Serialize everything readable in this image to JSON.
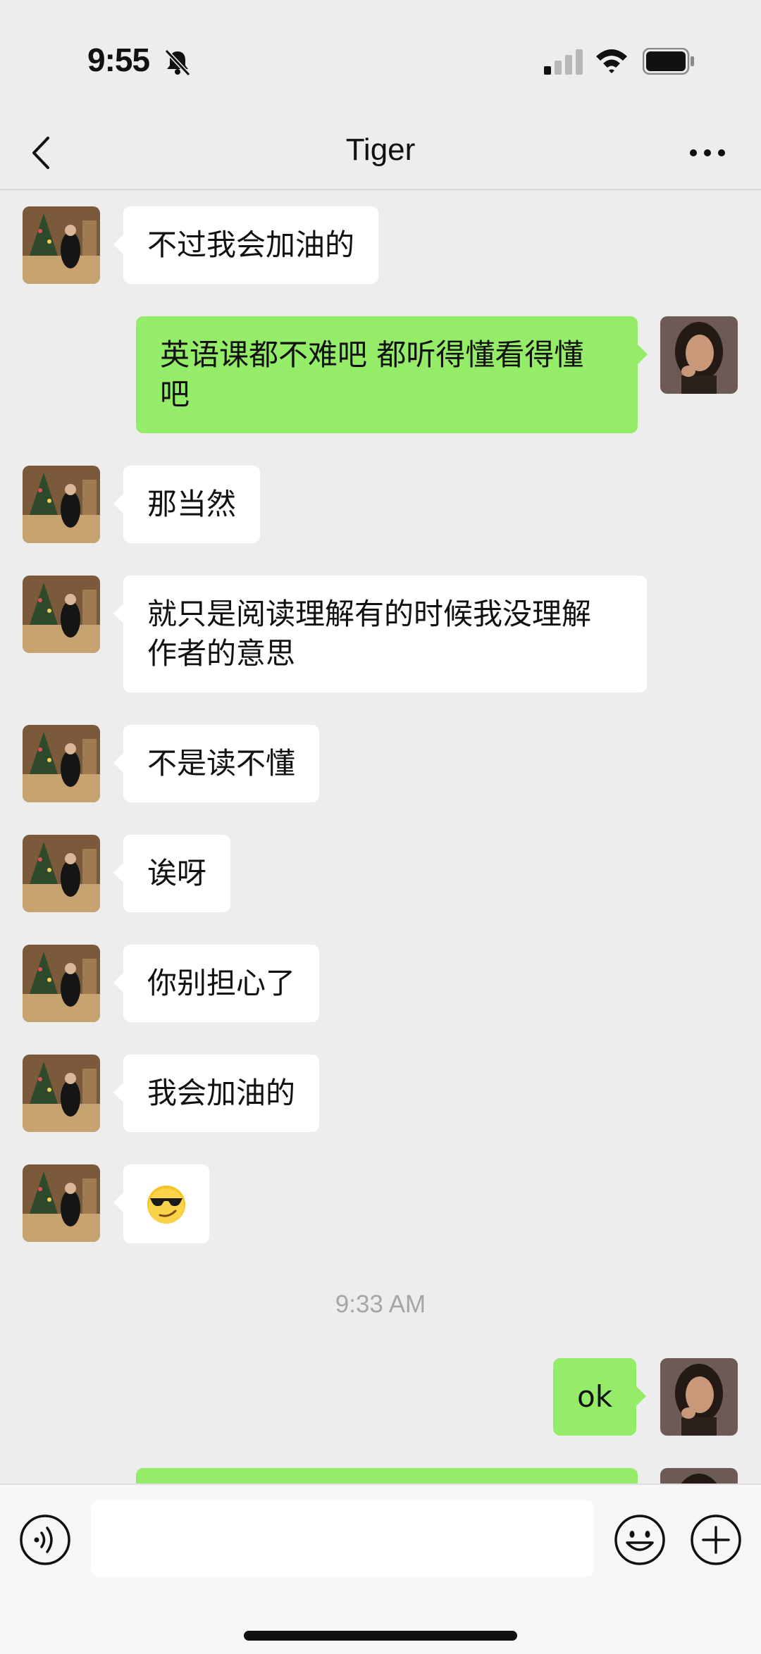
{
  "status_bar": {
    "time": "9:55"
  },
  "header": {
    "title": "Tiger"
  },
  "messages": [
    {
      "from": "them",
      "text": "不过我会加油的"
    },
    {
      "from": "me",
      "line1": "英语课都不难吧 都听得懂看得懂",
      "line2": "吧"
    },
    {
      "from": "them",
      "text": "那当然"
    },
    {
      "from": "them",
      "line1": "就只是阅读理解有的时候我没理解",
      "line2": "作者的意思"
    },
    {
      "from": "them",
      "text": "不是读不懂"
    },
    {
      "from": "them",
      "text": "诶呀"
    },
    {
      "from": "them",
      "text": "你别担心了"
    },
    {
      "from": "them",
      "text": "我会加油的"
    },
    {
      "from": "them",
      "emoji": "smirking-sunglasses-emoji"
    }
  ],
  "timestamp": "9:33 AM",
  "later_messages": [
    {
      "from": "me",
      "text": "ok"
    }
  ],
  "input": {
    "value": "",
    "placeholder": ""
  },
  "colors": {
    "outgoing_bubble": "#95ec69",
    "incoming_bubble": "#ffffff",
    "background": "#ededed"
  }
}
